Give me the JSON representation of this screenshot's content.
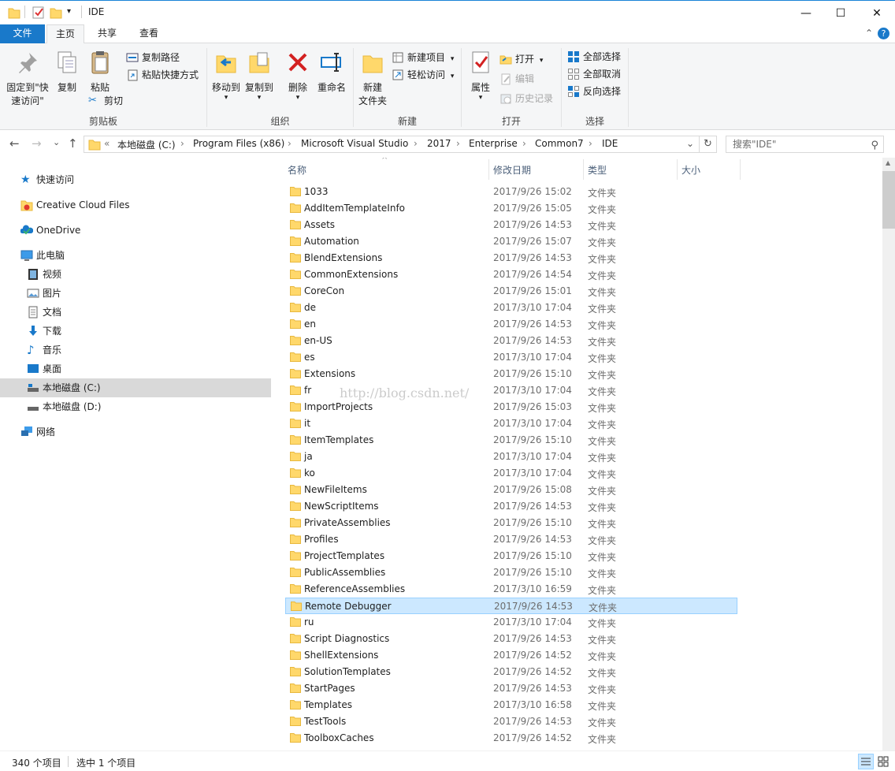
{
  "window": {
    "title": "IDE",
    "min_glyph": "—",
    "max_glyph": "☐",
    "close_glyph": "✕"
  },
  "tabs": [
    {
      "label": "文件"
    },
    {
      "label": "主页"
    },
    {
      "label": "共享"
    },
    {
      "label": "查看"
    }
  ],
  "ribbon_collapse_glyph": "⌃",
  "help_glyph": "?",
  "ribbon": {
    "clipboard": {
      "label": "剪贴板",
      "pin_line1": "固定到\"快",
      "pin_line2": "速访问\"",
      "copy": "复制",
      "paste": "粘贴",
      "copy_path": "复制路径",
      "paste_shortcut": "粘贴快捷方式",
      "cut": "剪切"
    },
    "organize": {
      "label": "组织",
      "move_to": "移动到",
      "copy_to": "复制到",
      "delete": "删除",
      "rename": "重命名"
    },
    "new": {
      "label": "新建",
      "new_folder_line1": "新建",
      "new_folder_line2": "文件夹",
      "new_item": "新建项目",
      "easy_access": "轻松访问"
    },
    "open": {
      "label": "打开",
      "properties": "属性",
      "open": "打开",
      "edit": "编辑",
      "history": "历史记录"
    },
    "select": {
      "label": "选择",
      "select_all": "全部选择",
      "select_none": "全部取消",
      "invert": "反向选择"
    }
  },
  "nav": {
    "back": "←",
    "forward": "→",
    "recent": "⌄",
    "up": "↑",
    "refresh": "↻"
  },
  "address": {
    "overflow": "«",
    "segments": [
      "本地磁盘 (C:)",
      "Program Files (x86)",
      "Microsoft Visual Studio",
      "2017",
      "Enterprise",
      "Common7",
      "IDE"
    ],
    "sep": "›",
    "dropdown": "⌄"
  },
  "search": {
    "placeholder": "搜索\"IDE\"",
    "icon": "⚲"
  },
  "navpane": {
    "quick_access": "快速访问",
    "creative_cloud": "Creative Cloud Files",
    "onedrive": "OneDrive",
    "this_pc": "此电脑",
    "videos": "视频",
    "pictures": "图片",
    "documents": "文档",
    "downloads": "下载",
    "music": "音乐",
    "desktop": "桌面",
    "drive_c": "本地磁盘 (C:)",
    "drive_d": "本地磁盘 (D:)",
    "network": "网络"
  },
  "columns": {
    "name": "名称",
    "date": "修改日期",
    "type": "类型",
    "size": "大小",
    "sort_glyph": "^"
  },
  "files": [
    {
      "name": "1033",
      "date": "2017/9/26 15:02",
      "type": "文件夹"
    },
    {
      "name": "AddItemTemplateInfo",
      "date": "2017/9/26 15:05",
      "type": "文件夹"
    },
    {
      "name": "Assets",
      "date": "2017/9/26 14:53",
      "type": "文件夹"
    },
    {
      "name": "Automation",
      "date": "2017/9/26 15:07",
      "type": "文件夹"
    },
    {
      "name": "BlendExtensions",
      "date": "2017/9/26 14:53",
      "type": "文件夹"
    },
    {
      "name": "CommonExtensions",
      "date": "2017/9/26 14:54",
      "type": "文件夹"
    },
    {
      "name": "CoreCon",
      "date": "2017/9/26 15:01",
      "type": "文件夹"
    },
    {
      "name": "de",
      "date": "2017/3/10 17:04",
      "type": "文件夹"
    },
    {
      "name": "en",
      "date": "2017/9/26 14:53",
      "type": "文件夹"
    },
    {
      "name": "en-US",
      "date": "2017/9/26 14:53",
      "type": "文件夹"
    },
    {
      "name": "es",
      "date": "2017/3/10 17:04",
      "type": "文件夹"
    },
    {
      "name": "Extensions",
      "date": "2017/9/26 15:10",
      "type": "文件夹"
    },
    {
      "name": "fr",
      "date": "2017/3/10 17:04",
      "type": "文件夹"
    },
    {
      "name": "ImportProjects",
      "date": "2017/9/26 15:03",
      "type": "文件夹"
    },
    {
      "name": "it",
      "date": "2017/3/10 17:04",
      "type": "文件夹"
    },
    {
      "name": "ItemTemplates",
      "date": "2017/9/26 15:10",
      "type": "文件夹"
    },
    {
      "name": "ja",
      "date": "2017/3/10 17:04",
      "type": "文件夹"
    },
    {
      "name": "ko",
      "date": "2017/3/10 17:04",
      "type": "文件夹"
    },
    {
      "name": "NewFileItems",
      "date": "2017/9/26 15:08",
      "type": "文件夹"
    },
    {
      "name": "NewScriptItems",
      "date": "2017/9/26 14:53",
      "type": "文件夹"
    },
    {
      "name": "PrivateAssemblies",
      "date": "2017/9/26 15:10",
      "type": "文件夹"
    },
    {
      "name": "Profiles",
      "date": "2017/9/26 14:53",
      "type": "文件夹"
    },
    {
      "name": "ProjectTemplates",
      "date": "2017/9/26 15:10",
      "type": "文件夹"
    },
    {
      "name": "PublicAssemblies",
      "date": "2017/9/26 15:10",
      "type": "文件夹"
    },
    {
      "name": "ReferenceAssemblies",
      "date": "2017/3/10 16:59",
      "type": "文件夹"
    },
    {
      "name": "Remote Debugger",
      "date": "2017/9/26 14:53",
      "type": "文件夹",
      "selected": true
    },
    {
      "name": "ru",
      "date": "2017/3/10 17:04",
      "type": "文件夹"
    },
    {
      "name": "Script Diagnostics",
      "date": "2017/9/26 14:53",
      "type": "文件夹"
    },
    {
      "name": "ShellExtensions",
      "date": "2017/9/26 14:52",
      "type": "文件夹"
    },
    {
      "name": "SolutionTemplates",
      "date": "2017/9/26 14:52",
      "type": "文件夹"
    },
    {
      "name": "StartPages",
      "date": "2017/9/26 14:53",
      "type": "文件夹"
    },
    {
      "name": "Templates",
      "date": "2017/3/10 16:58",
      "type": "文件夹"
    },
    {
      "name": "TestTools",
      "date": "2017/9/26 14:53",
      "type": "文件夹"
    },
    {
      "name": "ToolboxCaches",
      "date": "2017/9/26 14:52",
      "type": "文件夹"
    }
  ],
  "watermark": "http://blog.csdn.net/",
  "status": {
    "count": "340 个项目",
    "selected": "选中 1 个项目"
  },
  "colors": {
    "accent": "#1979ca",
    "folder": "#ffd86b",
    "folder_dark": "#e8b83e",
    "selection": "#cce8ff",
    "selection_border": "#99d1ff"
  }
}
